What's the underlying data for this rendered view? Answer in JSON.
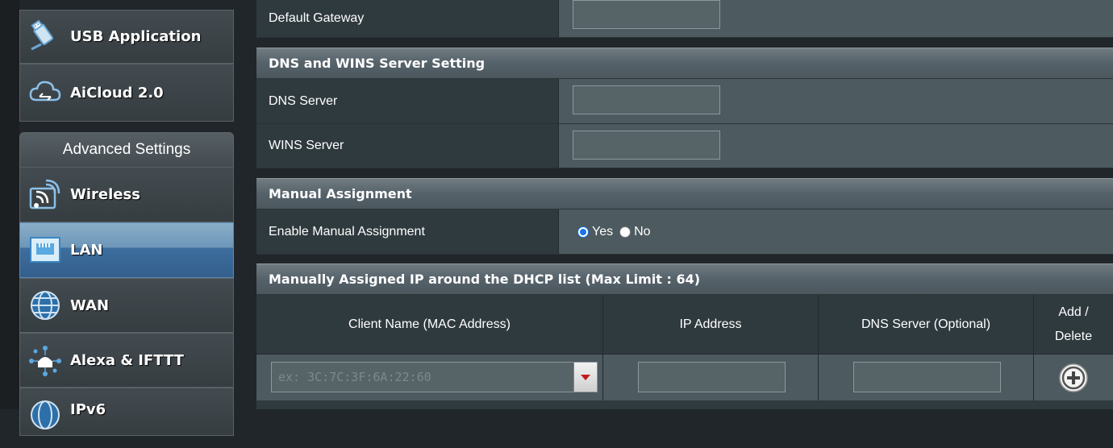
{
  "sidebar": {
    "top_items": [
      {
        "label": "USB Application",
        "icon": "usb-icon"
      },
      {
        "label": "AiCloud 2.0",
        "icon": "cloud-icon"
      }
    ],
    "advanced_header": "Advanced Settings",
    "advanced_items": [
      {
        "label": "Wireless",
        "icon": "wireless-icon"
      },
      {
        "label": "LAN",
        "icon": "lan-icon",
        "active": true
      },
      {
        "label": "WAN",
        "icon": "globe-icon"
      },
      {
        "label": "Alexa & IFTTT",
        "icon": "alexa-icon"
      },
      {
        "label": "IPv6",
        "icon": "ipv6-icon"
      }
    ]
  },
  "form": {
    "default_gateway_label": "Default Gateway",
    "default_gateway_value": "",
    "dns_wins_section": "DNS and WINS Server Setting",
    "dns_server_label": "DNS Server",
    "dns_server_value": "",
    "wins_server_label": "WINS Server",
    "wins_server_value": "",
    "manual_section": "Manual Assignment",
    "enable_manual_label": "Enable Manual Assignment",
    "yes_label": "Yes",
    "no_label": "No",
    "enable_manual_selected": "Yes"
  },
  "dhcp_list": {
    "title": "Manually Assigned IP around the DHCP list (Max Limit : 64)",
    "columns": [
      "Client Name (MAC Address)",
      "IP Address",
      "DNS Server (Optional)",
      "Add / Delete"
    ],
    "mac_placeholder": "ex: 3C:7C:3F:6A:22:60",
    "ip_value": "",
    "dns_value": ""
  },
  "colors": {
    "active_menu": "#3e6e9e",
    "radio_accent": "#1a73e8",
    "dropdown_arrow": "#c21b1b"
  }
}
